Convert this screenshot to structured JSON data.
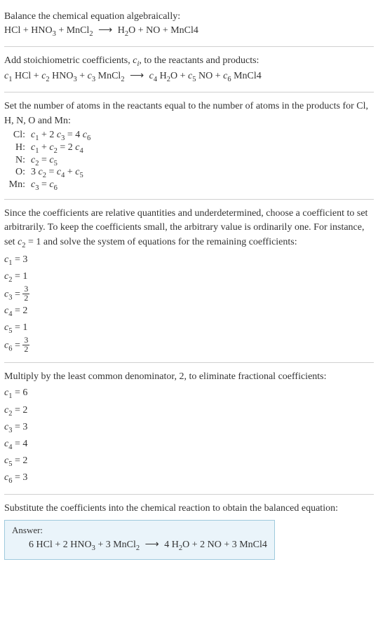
{
  "intro": {
    "title": "Balance the chemical equation algebraically:",
    "equation": "HCl + HNO₃ + MnCl₂  ⟶  H₂O + NO + MnCl4"
  },
  "stoich": {
    "text_before": "Add stoichiometric coefficients, ",
    "var": "c",
    "sub": "i",
    "text_after": ", to the reactants and products:",
    "equation": "c₁ HCl + c₂ HNO₃ + c₃ MnCl₂  ⟶  c₄ H₂O + c₅ NO + c₆ MnCl4"
  },
  "atoms": {
    "text": "Set the number of atoms in the reactants equal to the number of atoms in the products for Cl, H, N, O and Mn:",
    "rows": [
      {
        "label": "Cl:",
        "eq": "c₁ + 2 c₃ = 4 c₆"
      },
      {
        "label": "H:",
        "eq": "c₁ + c₂ = 2 c₄"
      },
      {
        "label": "N:",
        "eq": "c₂ = c₅"
      },
      {
        "label": "O:",
        "eq": "3 c₂ = c₄ + c₅"
      },
      {
        "label": "Mn:",
        "eq": "c₃ = c₆"
      }
    ]
  },
  "choose": {
    "text": "Since the coefficients are relative quantities and underdetermined, choose a coefficient to set arbitrarily. To keep the coefficients small, the arbitrary value is ordinarily one. For instance, set c₂ = 1 and solve the system of equations for the remaining coefficients:",
    "coeffs": [
      {
        "lhs": "c₁ =",
        "rhs": "3"
      },
      {
        "lhs": "c₂ =",
        "rhs": "1"
      },
      {
        "lhs": "c₃ =",
        "rhs": "3/2",
        "frac": true
      },
      {
        "lhs": "c₄ =",
        "rhs": "2"
      },
      {
        "lhs": "c₅ =",
        "rhs": "1"
      },
      {
        "lhs": "c₆ =",
        "rhs": "3/2",
        "frac": true
      }
    ]
  },
  "multiply": {
    "text": "Multiply by the least common denominator, 2, to eliminate fractional coefficients:",
    "coeffs": [
      {
        "lhs": "c₁ =",
        "rhs": "6"
      },
      {
        "lhs": "c₂ =",
        "rhs": "2"
      },
      {
        "lhs": "c₃ =",
        "rhs": "3"
      },
      {
        "lhs": "c₄ =",
        "rhs": "4"
      },
      {
        "lhs": "c₅ =",
        "rhs": "2"
      },
      {
        "lhs": "c₆ =",
        "rhs": "3"
      }
    ]
  },
  "substitute": {
    "text": "Substitute the coefficients into the chemical reaction to obtain the balanced equation:"
  },
  "answer": {
    "label": "Answer:",
    "equation": "6 HCl + 2 HNO₃ + 3 MnCl₂  ⟶  4 H₂O + 2 NO + 3 MnCl4"
  },
  "chart_data": {
    "type": "table",
    "title": "Balanced chemical equation coefficients",
    "reactants": [
      {
        "species": "HCl",
        "coefficient": 6
      },
      {
        "species": "HNO3",
        "coefficient": 2
      },
      {
        "species": "MnCl2",
        "coefficient": 3
      }
    ],
    "products": [
      {
        "species": "H2O",
        "coefficient": 4
      },
      {
        "species": "NO",
        "coefficient": 2
      },
      {
        "species": "MnCl4",
        "coefficient": 3
      }
    ],
    "atom_balance": [
      {
        "element": "Cl",
        "equation": "c1 + 2 c3 = 4 c6"
      },
      {
        "element": "H",
        "equation": "c1 + c2 = 2 c4"
      },
      {
        "element": "N",
        "equation": "c2 = c5"
      },
      {
        "element": "O",
        "equation": "3 c2 = c4 + c5"
      },
      {
        "element": "Mn",
        "equation": "c3 = c6"
      }
    ],
    "initial_solution_with_c2_1": {
      "c1": 3,
      "c2": 1,
      "c3": 1.5,
      "c4": 2,
      "c5": 1,
      "c6": 1.5
    },
    "scaled_solution": {
      "c1": 6,
      "c2": 2,
      "c3": 3,
      "c4": 4,
      "c5": 2,
      "c6": 3
    }
  }
}
